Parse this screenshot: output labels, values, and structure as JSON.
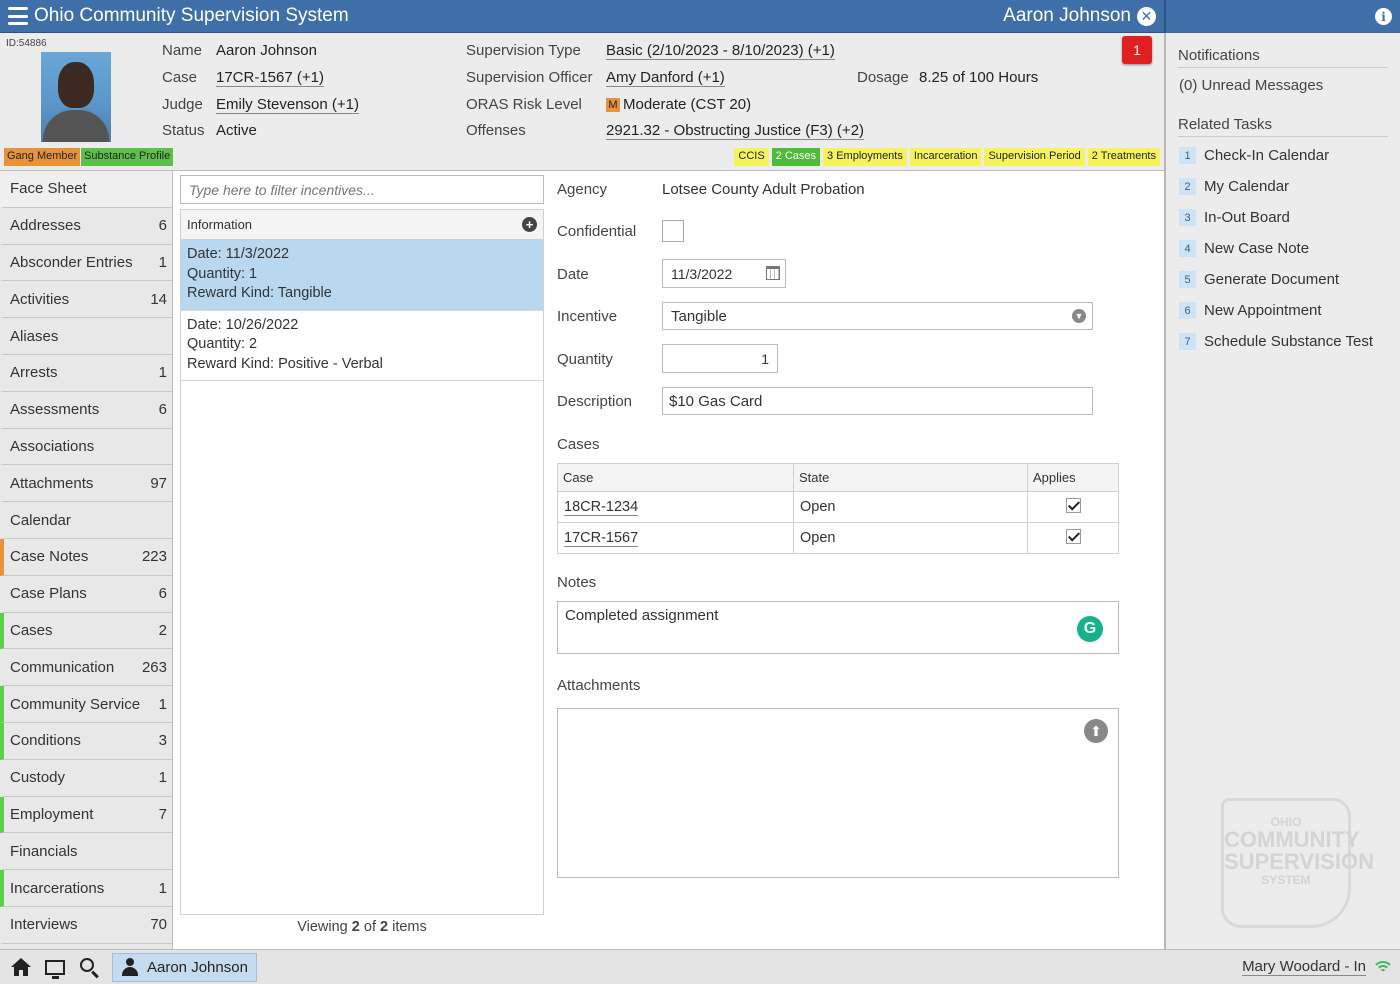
{
  "app": {
    "title": "Ohio Community Supervision System",
    "current_user_tab": "Aaron Johnson"
  },
  "client": {
    "id_label": "ID:54886",
    "tags": [
      "Gang Member",
      "Substance Profile"
    ],
    "alert_count": "1",
    "fields": {
      "name_label": "Name",
      "name": "Aaron Johnson",
      "case_label": "Case",
      "case": "17CR-1567 (+1)",
      "judge_label": "Judge",
      "judge": "Emily Stevenson (+1)",
      "status_label": "Status",
      "status": "Active",
      "supervision_type_label": "Supervision Type",
      "supervision_type": "Basic (2/10/2023 - 8/10/2023) (+1)",
      "officer_label": "Supervision Officer",
      "officer": "Amy Danford (+1)",
      "oras_label": "ORAS Risk Level",
      "oras_chip": "M",
      "oras": "Moderate (CST 20)",
      "offenses_label": "Offenses",
      "offenses": "2921.32 - Obstructing Justice (F3) (+2)",
      "dosage_label": "Dosage",
      "dosage": "8.25 of 100 Hours"
    },
    "chips": [
      {
        "label": "CCIS",
        "color": "#f6f45a"
      },
      {
        "label": "2 Cases",
        "color": "#4fbb3a"
      },
      {
        "label": "3 Employments",
        "color": "#f6f45a"
      },
      {
        "label": "Incarceration",
        "color": "#f6f45a"
      },
      {
        "label": "Supervision Period",
        "color": "#f6f45a"
      },
      {
        "label": "2 Treatments",
        "color": "#f6f45a"
      }
    ]
  },
  "sidebar": {
    "items": [
      {
        "label": "Face Sheet",
        "count": ""
      },
      {
        "label": "Addresses",
        "count": "6"
      },
      {
        "label": "Absconder Entries",
        "count": "1"
      },
      {
        "label": "Activities",
        "count": "14"
      },
      {
        "label": "Aliases",
        "count": ""
      },
      {
        "label": "Arrests",
        "count": "1"
      },
      {
        "label": "Assessments",
        "count": "6"
      },
      {
        "label": "Associations",
        "count": ""
      },
      {
        "label": "Attachments",
        "count": "97"
      },
      {
        "label": "Calendar",
        "count": ""
      },
      {
        "label": "Case Notes",
        "count": "223"
      },
      {
        "label": "Case Plans",
        "count": "6"
      },
      {
        "label": "Cases",
        "count": "2"
      },
      {
        "label": "Communication",
        "count": "263"
      },
      {
        "label": "Community Service",
        "count": "1"
      },
      {
        "label": "Conditions",
        "count": "3"
      },
      {
        "label": "Custody",
        "count": "1"
      },
      {
        "label": "Employment",
        "count": "7"
      },
      {
        "label": "Financials",
        "count": ""
      },
      {
        "label": "Incarcerations",
        "count": "1"
      },
      {
        "label": "Interviews",
        "count": "70"
      }
    ]
  },
  "incentives": {
    "filter_placeholder": "Type here to filter incentives...",
    "list_header": "Information",
    "items": [
      {
        "date": "Date: 11/3/2022",
        "quantity": "Quantity: 1",
        "reward": "Reward Kind: Tangible"
      },
      {
        "date": "Date: 10/26/2022",
        "quantity": "Quantity: 2",
        "reward": "Reward Kind: Positive - Verbal"
      }
    ],
    "viewing_prefix": "Viewing ",
    "viewing_count": "2",
    "viewing_mid": " of ",
    "viewing_total": "2",
    "viewing_suffix": " items"
  },
  "detail": {
    "agency_label": "Agency",
    "agency": "Lotsee County Adult Probation",
    "confidential_label": "Confidential",
    "date_label": "Date",
    "date": "11/3/2022",
    "incentive_label": "Incentive",
    "incentive": "Tangible",
    "quantity_label": "Quantity",
    "quantity": "1",
    "description_label": "Description",
    "description": "$10 Gas Card",
    "cases_label": "Cases",
    "cases_columns": [
      "Case",
      "State",
      "Applies"
    ],
    "cases_rows": [
      {
        "case": "18CR-1234",
        "state": "Open"
      },
      {
        "case": "17CR-1567",
        "state": "Open"
      }
    ],
    "notes_label": "Notes",
    "notes": "Completed assignment",
    "attachments_label": "Attachments"
  },
  "rightpanel": {
    "notifications_heading": "Notifications",
    "unread": "(0) Unread Messages",
    "tasks_heading": "Related Tasks",
    "tasks": [
      {
        "num": "1",
        "label": "Check-In Calendar"
      },
      {
        "num": "2",
        "label": "My Calendar"
      },
      {
        "num": "3",
        "label": "In-Out Board"
      },
      {
        "num": "4",
        "label": "New Case Note"
      },
      {
        "num": "5",
        "label": "Generate Document"
      },
      {
        "num": "6",
        "label": "New Appointment"
      },
      {
        "num": "7",
        "label": "Schedule Substance Test"
      }
    ],
    "watermark": [
      "OHIO",
      "COMMUNITY",
      "SUPERVISION",
      "SYSTEM"
    ]
  },
  "bottombar": {
    "user_tab": "Aaron Johnson",
    "status": "Mary Woodard - In"
  }
}
